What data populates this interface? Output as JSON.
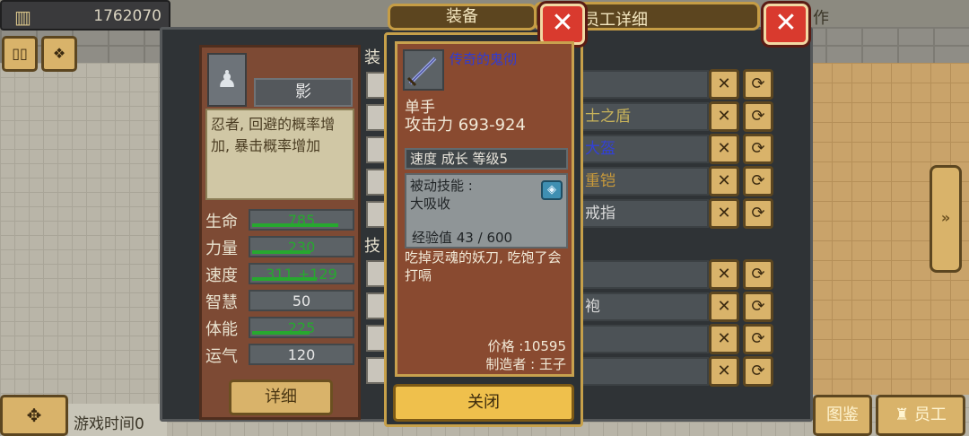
{
  "top_bar": {
    "money": "1762070"
  },
  "right_top_label": "作",
  "game_time_label": "游戏时间0",
  "bottom_buttons": {
    "encyclopedia": "图鉴",
    "staff": "员工"
  },
  "staff_panel": {
    "title": "员工详细",
    "name": "影",
    "description": "忍者, 回避的概率增加, 暴击概率增加",
    "stats": [
      {
        "label": "生命",
        "value": "785",
        "fill": 0.86,
        "color": "#27a82f"
      },
      {
        "label": "力量",
        "value": "230",
        "fill": 0.58,
        "color": "#27a82f"
      },
      {
        "label": "速度",
        "value": "311 +129",
        "fill": 0.64,
        "color": "#27a82f"
      },
      {
        "label": "智慧",
        "value": "50",
        "fill": 0.0,
        "color": "#e8e8e8"
      },
      {
        "label": "体能",
        "value": "225",
        "fill": 0.57,
        "color": "#27a82f"
      },
      {
        "label": "运气",
        "value": "120",
        "fill": 0.0,
        "color": "#e8e8e8"
      }
    ],
    "detail_button": "详细",
    "side_labels": [
      "装",
      "技"
    ],
    "equipment_rows": [
      {
        "name": "",
        "color": "#3341d6"
      },
      {
        "name": "士之盾",
        "color": "#c7b25a"
      },
      {
        "name": "大盔",
        "color": "#3341d6"
      },
      {
        "name": "重铠",
        "color": "#c99a3b"
      },
      {
        "name": "戒指",
        "color": "#d9d9d9"
      },
      {
        "name": "",
        "color": "#d9d9d9"
      },
      {
        "name": "袍",
        "color": "#d9d9d9"
      },
      {
        "name": "",
        "color": "#d9d9d9"
      },
      {
        "name": "",
        "color": "#d9d9d9"
      }
    ]
  },
  "equip_popup": {
    "title": "装备",
    "item_name": "传奇的鬼彻",
    "item_type": "单手",
    "attack": "攻击力 693-924",
    "growth_line": "速度 成长 等级5",
    "skill_title": "被动技能 :",
    "skill_name": "大吸收",
    "exp": "经验值 43 / 600",
    "flavor_text": "吃掉灵魂的妖刀, 吃饱了会打嗝",
    "price": "价格 :10595",
    "maker": "制造者 : 王子",
    "close_button": "关闭"
  }
}
